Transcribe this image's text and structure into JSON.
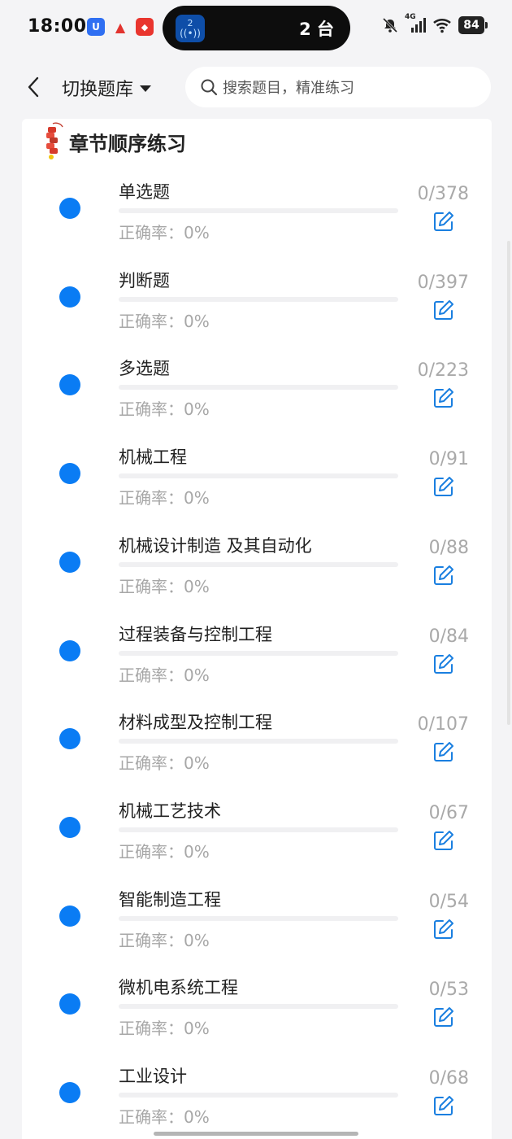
{
  "status_bar": {
    "time": "18:00",
    "island_badge_number": "2",
    "island_text": "2 台",
    "network": "4G",
    "battery": "84"
  },
  "header": {
    "switch_label": "切换题库",
    "search_placeholder": "搜索题目，精准练习"
  },
  "card": {
    "title": "章节顺序练习",
    "accuracy_label": "正确率：0%",
    "items": [
      {
        "name": "单选题",
        "done": 0,
        "total": 378,
        "count": "0/378",
        "accuracy": "正确率：0%",
        "progress": 0
      },
      {
        "name": "判断题",
        "done": 0,
        "total": 397,
        "count": "0/397",
        "accuracy": "正确率：0%",
        "progress": 0
      },
      {
        "name": "多选题",
        "done": 0,
        "total": 223,
        "count": "0/223",
        "accuracy": "正确率：0%",
        "progress": 0
      },
      {
        "name": "机械工程",
        "done": 0,
        "total": 91,
        "count": "0/91",
        "accuracy": "正确率：0%",
        "progress": 0
      },
      {
        "name": "机械设计制造 及其自动化",
        "done": 0,
        "total": 88,
        "count": "0/88",
        "accuracy": "正确率：0%",
        "progress": 0
      },
      {
        "name": "过程装备与控制工程",
        "done": 0,
        "total": 84,
        "count": "0/84",
        "accuracy": "正确率：0%",
        "progress": 0
      },
      {
        "name": "材料成型及控制工程",
        "done": 0,
        "total": 107,
        "count": "0/107",
        "accuracy": "正确率：0%",
        "progress": 0
      },
      {
        "name": "机械工艺技术",
        "done": 0,
        "total": 67,
        "count": "0/67",
        "accuracy": "正确率：0%",
        "progress": 0
      },
      {
        "name": "智能制造工程",
        "done": 0,
        "total": 54,
        "count": "0/54",
        "accuracy": "正确率：0%",
        "progress": 0
      },
      {
        "name": "微机电系统工程",
        "done": 0,
        "total": 53,
        "count": "0/53",
        "accuracy": "正确率：0%",
        "progress": 0
      },
      {
        "name": "工业设计",
        "done": 0,
        "total": 68,
        "count": "0/68",
        "accuracy": "正确率：0%",
        "progress": 0
      }
    ]
  },
  "icons": {
    "back": "chevron-left-icon",
    "dropdown": "caret-down-icon",
    "search": "search-icon",
    "title_decoration": "firecracker-icon",
    "edit": "edit-icon",
    "status_dot": "dot-icon"
  },
  "colors": {
    "accent": "#0a7cf4",
    "count_text": "#a9a9a9",
    "accuracy_text": "#a7a7a7",
    "page_bg": "#f4f4f6",
    "card_bg": "#ffffff"
  }
}
